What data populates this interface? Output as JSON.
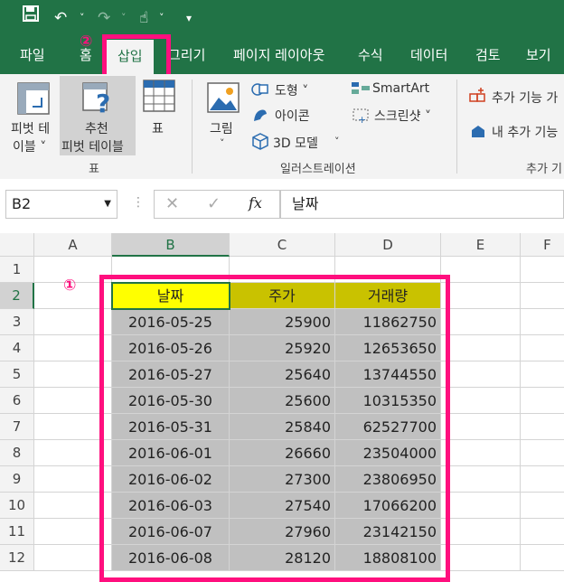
{
  "quick_access": {
    "save": "save-icon",
    "undo": "undo-icon",
    "redo": "redo-icon",
    "touch": "touch-mode-icon",
    "more": "customize-icon"
  },
  "tabs": [
    "파일",
    "홈",
    "삽입",
    "그리기",
    "페이지 레이아웃",
    "수식",
    "데이터",
    "검토",
    "보기"
  ],
  "annotations": {
    "one": "①",
    "two": "②"
  },
  "ribbon": {
    "pivot": {
      "line1": "피벗 테",
      "line2": "이블 ˅"
    },
    "rec_pivot": {
      "line1": "추천",
      "line2": "피벗 테이블"
    },
    "table_label": "표",
    "group_tables": "표",
    "picture": "그림",
    "picture_arrow": "˅",
    "shapes": "도형 ˅",
    "icons": "아이콘",
    "model3d": "3D 모델",
    "model3d_arrow": "˅",
    "smartart": "SmartArt",
    "screenshot": "스크린샷 ˅",
    "group_illustrations": "일러스트레이션",
    "addin1": "추가 기능 가",
    "addin2": "내 추가 기능",
    "group_addins": "추가 기"
  },
  "formula_bar": {
    "name_box": "B2",
    "value": "날짜",
    "fx": "fx"
  },
  "columns": [
    "A",
    "B",
    "C",
    "D",
    "E",
    "F"
  ],
  "rows": [
    "1",
    "2",
    "3",
    "4",
    "5",
    "6",
    "7",
    "8",
    "9",
    "10",
    "11",
    "12"
  ],
  "table": {
    "headers": [
      "날짜",
      "주가",
      "거래량"
    ],
    "rows": [
      [
        "2016-05-25",
        "25900",
        "11862750"
      ],
      [
        "2016-05-26",
        "25920",
        "12653650"
      ],
      [
        "2016-05-27",
        "25640",
        "13744550"
      ],
      [
        "2016-05-30",
        "25600",
        "10315350"
      ],
      [
        "2016-05-31",
        "25840",
        "62527700"
      ],
      [
        "2016-06-01",
        "26660",
        "23504000"
      ],
      [
        "2016-06-02",
        "27300",
        "23806950"
      ],
      [
        "2016-06-03",
        "27540",
        "17066200"
      ],
      [
        "2016-06-07",
        "27960",
        "23142150"
      ],
      [
        "2016-06-08",
        "28120",
        "18808100"
      ]
    ]
  }
}
